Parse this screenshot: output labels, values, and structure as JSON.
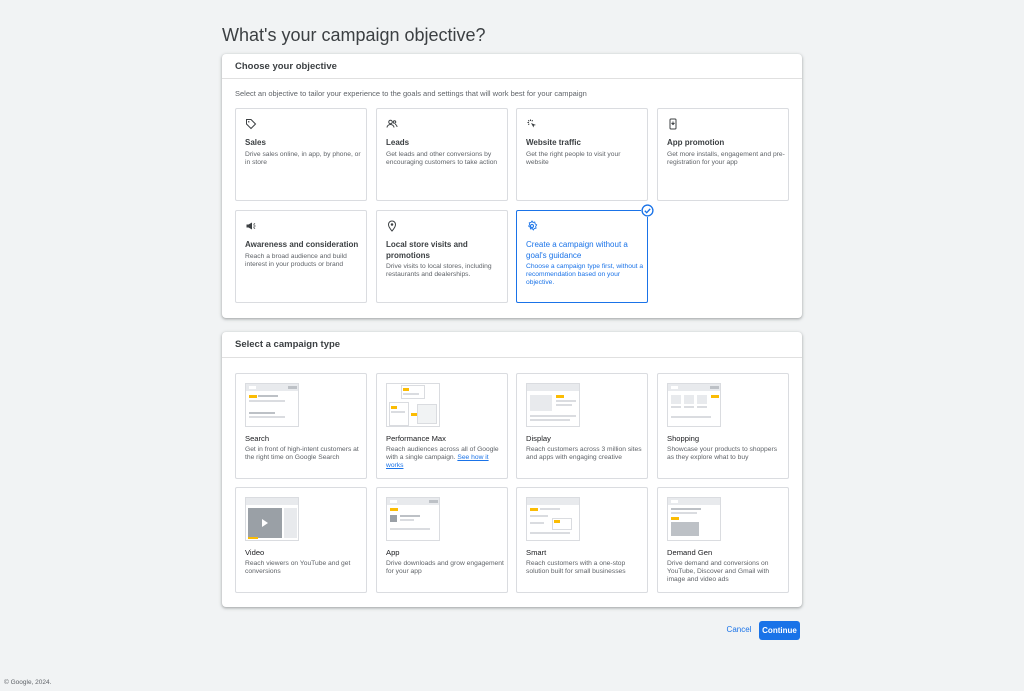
{
  "page": {
    "title": "What's your campaign objective?"
  },
  "objective_section": {
    "header": "Choose your objective",
    "subtitle": "Select an objective to tailor your experience to the goals and settings that will work best for your campaign",
    "cards": [
      {
        "icon": "tag-icon",
        "title": "Sales",
        "desc": "Drive sales online, in app, by phone, or in store"
      },
      {
        "icon": "people-icon",
        "title": "Leads",
        "desc": "Get leads and other conversions by encouraging customers to take action"
      },
      {
        "icon": "cursor-click-icon",
        "title": "Website traffic",
        "desc": "Get the right people to visit your website"
      },
      {
        "icon": "phone-icon",
        "title": "App promotion",
        "desc": "Get more installs, engagement and pre-registration for your app"
      },
      {
        "icon": "megaphone-icon",
        "title": "Awareness and consideration",
        "desc": "Reach a broad audience and build interest in your products or brand"
      },
      {
        "icon": "location-pin-icon",
        "title": "Local store visits and promotions",
        "desc": "Drive visits to local stores, including restaurants and dealerships."
      },
      {
        "icon": "gear-icon",
        "title": "Create a campaign without a goal's guidance",
        "desc": "Choose a campaign type first, without a recommendation based on your objective.",
        "selected": true
      }
    ]
  },
  "type_section": {
    "header": "Select a campaign type",
    "cards": [
      {
        "title": "Search",
        "desc": "Get in front of high-intent customers at the right time on Google Search"
      },
      {
        "title": "Performance Max",
        "desc": "Reach audiences across all of Google with a single campaign.",
        "link": "See how it works"
      },
      {
        "title": "Display",
        "desc": "Reach customers across 3 million sites and apps with engaging creative"
      },
      {
        "title": "Shopping",
        "desc": "Showcase your products to shoppers as they explore what to buy"
      },
      {
        "title": "Video",
        "desc": "Reach viewers on YouTube and get conversions"
      },
      {
        "title": "App",
        "desc": "Drive downloads and grow engagement for your app"
      },
      {
        "title": "Smart",
        "desc": "Reach customers with a one-stop solution built for small businesses"
      },
      {
        "title": "Demand Gen",
        "desc": "Drive demand and conversions on YouTube, Discover and Gmail with image and video ads"
      }
    ]
  },
  "actions": {
    "cancel": "Cancel",
    "continue": "Continue"
  },
  "footer": {
    "copyright": "© Google, 2024."
  },
  "colors": {
    "accent": "#1a73e8",
    "thumb_yellow": "#fbbc04"
  }
}
